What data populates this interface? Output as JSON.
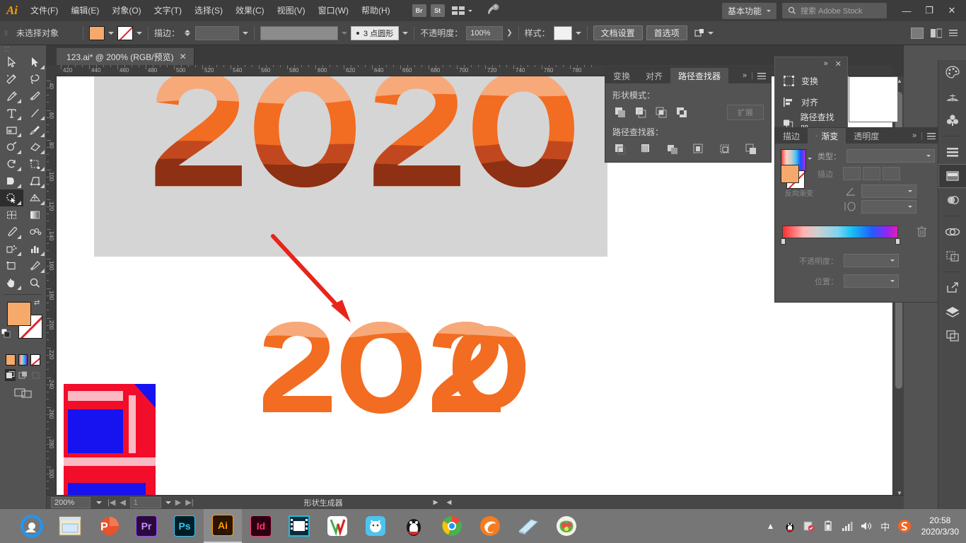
{
  "menubar": {
    "logo": "Ai",
    "items": [
      {
        "label": "文件(F)"
      },
      {
        "label": "编辑(E)"
      },
      {
        "label": "对象(O)"
      },
      {
        "label": "文字(T)"
      },
      {
        "label": "选择(S)"
      },
      {
        "label": "效果(C)"
      },
      {
        "label": "视图(V)"
      },
      {
        "label": "窗口(W)"
      },
      {
        "label": "帮助(H)"
      }
    ],
    "bridge_label": "Br",
    "stock_label": "St",
    "workspace": "基本功能",
    "search_placeholder": "搜索 Adobe Stock",
    "minimize": "—",
    "restore": "❐",
    "close": "✕"
  },
  "controlbar": {
    "selection_status": "未选择对象",
    "stroke_label": "描边：",
    "stroke_weight": "",
    "profile_label": "3 点圆形",
    "opacity_label": "不透明度：",
    "opacity_value": "100%",
    "style_label": "样式：",
    "doc_setup": "文档设置",
    "preferences": "首选项",
    "fill_color": "#F5A96A",
    "stroke_color": "none"
  },
  "document": {
    "tab_title": "123.ai* @ 200% (RGB/预览)",
    "tab_close": "✕"
  },
  "rulers": {
    "horizontal": [
      "420",
      "440",
      "460",
      "480",
      "500",
      "520",
      "540",
      "560",
      "580",
      "600",
      "620",
      "640",
      "660",
      "680",
      "700",
      "720",
      "740",
      "760",
      "780"
    ],
    "vertical": [
      "40",
      "60",
      "80",
      "100",
      "120",
      "140",
      "160",
      "180",
      "200",
      "220",
      "240",
      "260",
      "280",
      "300"
    ]
  },
  "artwork": {
    "top_text": "2020",
    "bottom_text": "2020",
    "orange": "#F26C21",
    "light_peach": "#F8A270",
    "dark_brown": "#8E3014",
    "mid_brown": "#B8441C",
    "board_bg": "#D5D5D5",
    "arrow_color": "#E8241B"
  },
  "statusbar": {
    "zoom": "200%",
    "page": "1",
    "active_tool": "形状生成器"
  },
  "pathfinder_panel": {
    "tabs": [
      {
        "label": "变换",
        "active": false
      },
      {
        "label": "对齐",
        "active": false
      },
      {
        "label": "路径查找器",
        "active": true
      }
    ],
    "shape_modes_label": "形状模式：",
    "expand_label": "扩展",
    "pathfinders_label": "路径查找器：",
    "shape_mode_icons": [
      "unite-icon",
      "minus-front-icon",
      "intersect-icon",
      "exclude-icon"
    ],
    "pathfinder_icons": [
      "divide-icon",
      "trim-icon",
      "merge-icon",
      "crop-icon",
      "outline-icon",
      "minus-back-icon"
    ],
    "collapse": "»",
    "menu": "≡"
  },
  "panel_menu": {
    "collapse": "»",
    "close": "✕",
    "items": [
      {
        "label": "变换",
        "icon": "transform-icon"
      },
      {
        "label": "对齐",
        "icon": "align-icon"
      },
      {
        "label": "路径查找器",
        "icon": "pathfinder-icon"
      }
    ]
  },
  "gradient_panel": {
    "tabs": [
      {
        "label": "描边",
        "active": false
      },
      {
        "label": "渐变",
        "active": true
      },
      {
        "label": "透明度",
        "active": false
      }
    ],
    "type_label": "类型：",
    "type_value": "",
    "stroke_label": "描边",
    "angle_label": "角度",
    "aspect_label": "长宽比",
    "reverse_label": "反向渐变",
    "opacity_label": "不透明度：",
    "opacity_value": "",
    "location_label": "位置：",
    "location_value": "",
    "collapse": "»",
    "menu": "≡",
    "fill_color": "#F5A96A"
  },
  "toolbar": {
    "handle": "⁚⁚",
    "tools": [
      {
        "name": "selection-tool"
      },
      {
        "name": "direct-selection-tool"
      },
      {
        "name": "magic-wand-tool"
      },
      {
        "name": "lasso-tool"
      },
      {
        "name": "pen-tool"
      },
      {
        "name": "curvature-tool"
      },
      {
        "name": "type-tool"
      },
      {
        "name": "line-segment-tool"
      },
      {
        "name": "rectangle-tool"
      },
      {
        "name": "paintbrush-tool"
      },
      {
        "name": "shaper-tool"
      },
      {
        "name": "eraser-tool"
      },
      {
        "name": "rotate-tool"
      },
      {
        "name": "scale-tool"
      },
      {
        "name": "width-tool"
      },
      {
        "name": "free-transform-tool"
      },
      {
        "name": "shape-builder-tool"
      },
      {
        "name": "perspective-grid-tool"
      },
      {
        "name": "mesh-tool"
      },
      {
        "name": "gradient-tool"
      },
      {
        "name": "eyedropper-tool"
      },
      {
        "name": "blend-tool"
      },
      {
        "name": "symbol-sprayer-tool"
      },
      {
        "name": "column-graph-tool"
      },
      {
        "name": "artboard-tool"
      },
      {
        "name": "slice-tool"
      },
      {
        "name": "hand-tool"
      },
      {
        "name": "zoom-tool"
      }
    ],
    "fill_color": "#F5A96A",
    "stroke_color": "#FFFFFF",
    "mode_swatches": [
      "color-swatch",
      "gradient-swatch",
      "none-swatch"
    ],
    "draw_modes": [
      "draw-normal",
      "draw-behind",
      "draw-inside"
    ],
    "screen_mode": "screen-mode-icon"
  },
  "dock": {
    "buttons": [
      {
        "name": "color-panel-icon"
      },
      {
        "name": "color-guide-icon"
      },
      {
        "name": "brushes-icon"
      },
      {
        "name": "symbols-icon"
      },
      {
        "name": "swatches-icon"
      },
      {
        "name": "graphic-styles-icon"
      },
      {
        "name": "align-panel-icon"
      },
      {
        "name": "artboards-icon"
      },
      {
        "name": "transparency-icon"
      },
      {
        "name": "libraries-icon"
      },
      {
        "name": "asset-export-icon"
      },
      {
        "name": "layers-icon"
      },
      {
        "name": "links-icon"
      }
    ]
  },
  "taskbar": {
    "apps": [
      {
        "name": "browser-app-icon",
        "label": ""
      },
      {
        "name": "file-explorer-icon",
        "label": ""
      },
      {
        "name": "powerpoint-icon",
        "label": "P"
      },
      {
        "name": "premiere-icon",
        "label": "Pr"
      },
      {
        "name": "photoshop-icon",
        "label": "Ps"
      },
      {
        "name": "illustrator-icon",
        "label": "Ai",
        "active": true
      },
      {
        "name": "indesign-icon",
        "label": "Id"
      },
      {
        "name": "media-player-icon",
        "label": ""
      },
      {
        "name": "wps-icon",
        "label": ""
      },
      {
        "name": "thunder-icon",
        "label": ""
      },
      {
        "name": "qq-icon",
        "label": ""
      },
      {
        "name": "chrome-icon",
        "label": ""
      },
      {
        "name": "firefox-icon",
        "label": ""
      },
      {
        "name": "window-app-icon",
        "label": ""
      },
      {
        "name": "game-app-icon",
        "label": ""
      }
    ],
    "tray": [
      {
        "name": "show-hidden-icons",
        "glyph": "▲"
      },
      {
        "name": "qq-tray-icon",
        "glyph": ""
      },
      {
        "name": "security-tray-icon",
        "glyph": ""
      },
      {
        "name": "battery-icon",
        "glyph": ""
      },
      {
        "name": "network-icon",
        "glyph": ""
      },
      {
        "name": "volume-icon",
        "glyph": ""
      },
      {
        "name": "ime-icon",
        "glyph": "中"
      },
      {
        "name": "sogou-icon",
        "glyph": "S"
      }
    ],
    "time": "20:58",
    "date": "2020/3/30"
  }
}
